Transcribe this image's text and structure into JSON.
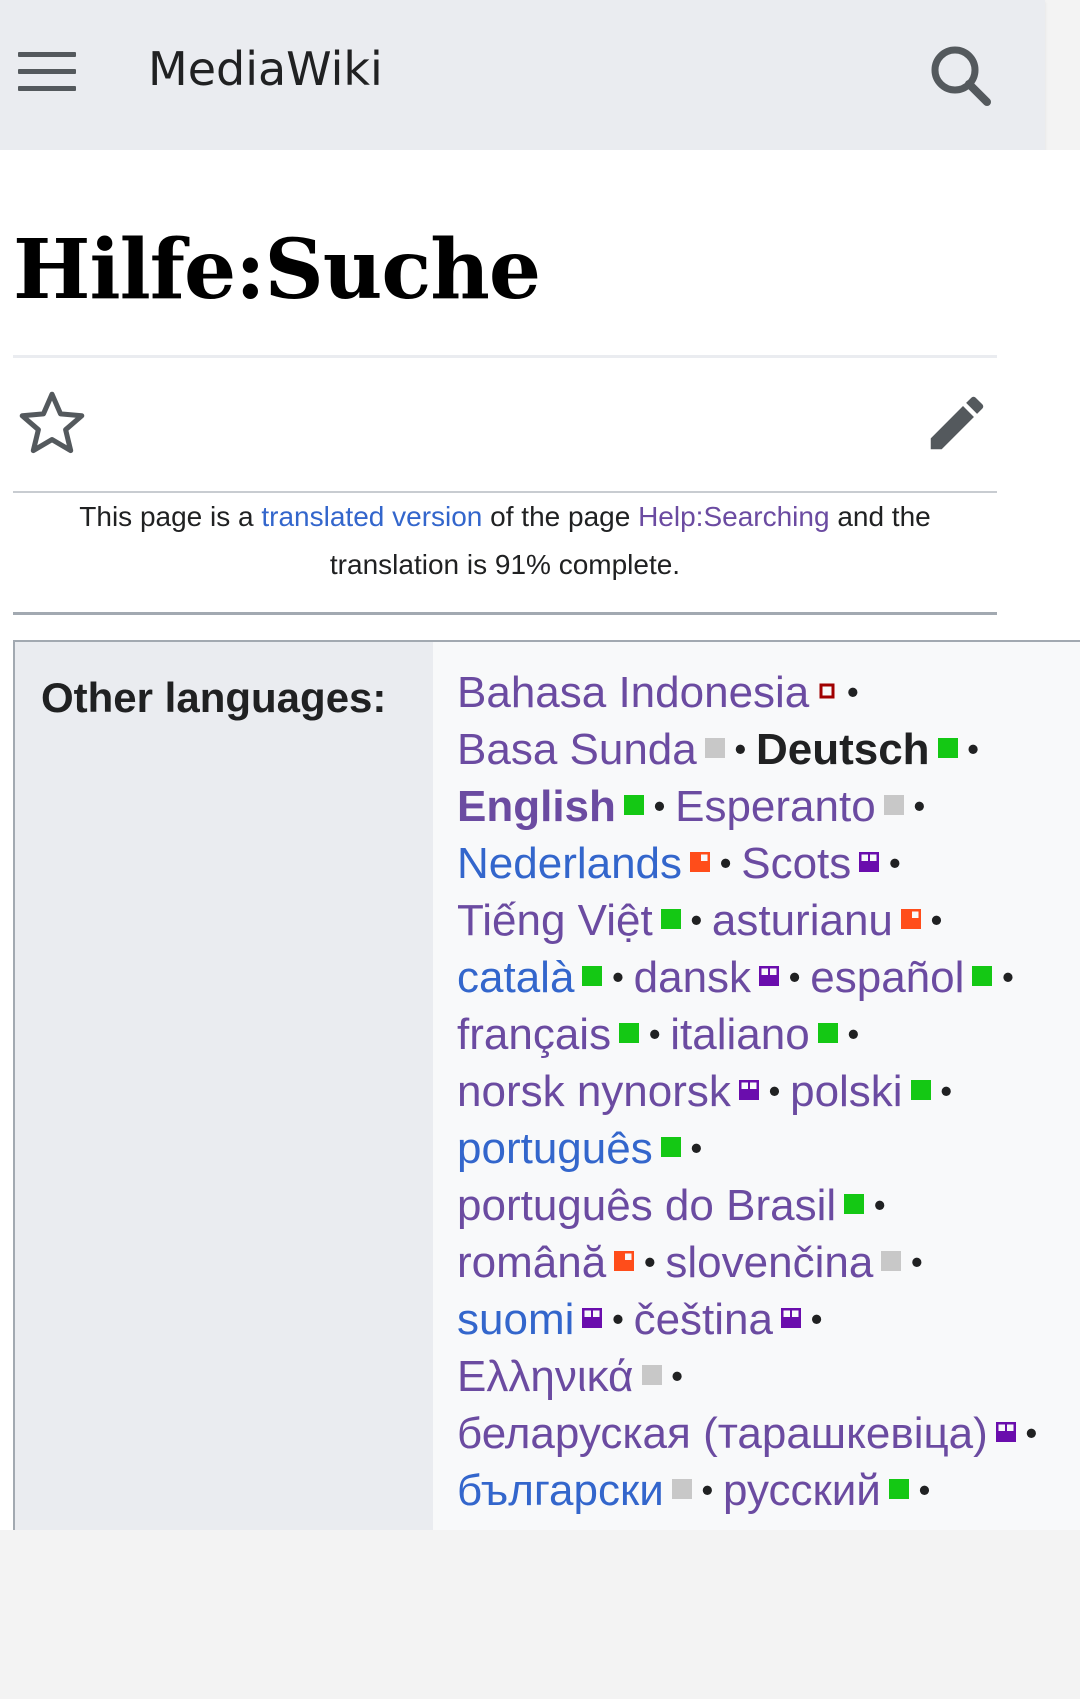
{
  "header": {
    "title": "MediaWiki",
    "menu_icon": "hamburger-menu-icon",
    "search_icon": "search-icon"
  },
  "page": {
    "title": "Hilfe:Suche",
    "watch_icon": "star-icon",
    "edit_icon": "pencil-icon"
  },
  "notice": {
    "prefix": "This page is a",
    "link1": "translated version",
    "middle": "of the page",
    "link2": "Help:Searching",
    "suffix": "and the translation is 91% complete."
  },
  "languages": {
    "label": "Other languages:",
    "separator": "•",
    "rows": [
      [
        {
          "name": "Bahasa Indonesia",
          "style": "visited",
          "status": "dark-red"
        }
      ],
      [
        {
          "name": "Basa Sunda",
          "style": "visited",
          "status": "grey"
        },
        {
          "name": "Deutsch",
          "style": "current",
          "status": "green"
        }
      ],
      [
        {
          "name": "English",
          "style": "visited-bold",
          "status": "green"
        },
        {
          "name": "Esperanto",
          "style": "visited",
          "status": "grey"
        }
      ],
      [
        {
          "name": "Nederlands",
          "style": "link",
          "status": "orange"
        },
        {
          "name": "Scots",
          "style": "visited",
          "status": "purple"
        }
      ],
      [
        {
          "name": "Tiếng Việt",
          "style": "visited",
          "status": "green"
        },
        {
          "name": "asturianu",
          "style": "visited",
          "status": "orange"
        }
      ],
      [
        {
          "name": "català",
          "style": "link",
          "status": "green"
        },
        {
          "name": "dansk",
          "style": "visited",
          "status": "purple"
        },
        {
          "name": "español",
          "style": "visited",
          "status": "green"
        }
      ],
      [
        {
          "name": "français",
          "style": "visited",
          "status": "green"
        },
        {
          "name": "italiano",
          "style": "visited",
          "status": "green"
        }
      ],
      [
        {
          "name": "norsk nynorsk",
          "style": "visited",
          "status": "purple"
        },
        {
          "name": "polski",
          "style": "visited",
          "status": "green"
        }
      ],
      [
        {
          "name": "português",
          "style": "link",
          "status": "green"
        }
      ],
      [
        {
          "name": "português do Brasil",
          "style": "visited",
          "status": "green"
        }
      ],
      [
        {
          "name": "română",
          "style": "visited",
          "status": "orange"
        },
        {
          "name": "slovenčina",
          "style": "visited",
          "status": "grey"
        }
      ],
      [
        {
          "name": "suomi",
          "style": "link",
          "status": "purple"
        },
        {
          "name": "čeština",
          "style": "visited",
          "status": "purple"
        }
      ],
      [
        {
          "name": "Ελληνικά",
          "style": "visited",
          "status": "grey"
        }
      ],
      [
        {
          "name": "беларуская (тарашкевіца)",
          "style": "visited",
          "status": "purple"
        }
      ],
      [
        {
          "name": "български",
          "style": "link",
          "status": "grey"
        },
        {
          "name": "русский",
          "style": "visited",
          "status": "green"
        }
      ]
    ]
  },
  "colors": {
    "link": "#3366cc",
    "visited": "#6b4ba1",
    "status_green": "#14c814",
    "status_orange": "#ff4d1a",
    "status_purple": "#6a0dad",
    "status_grey": "#c8c8c8",
    "status_dark_red": "#a00000"
  }
}
